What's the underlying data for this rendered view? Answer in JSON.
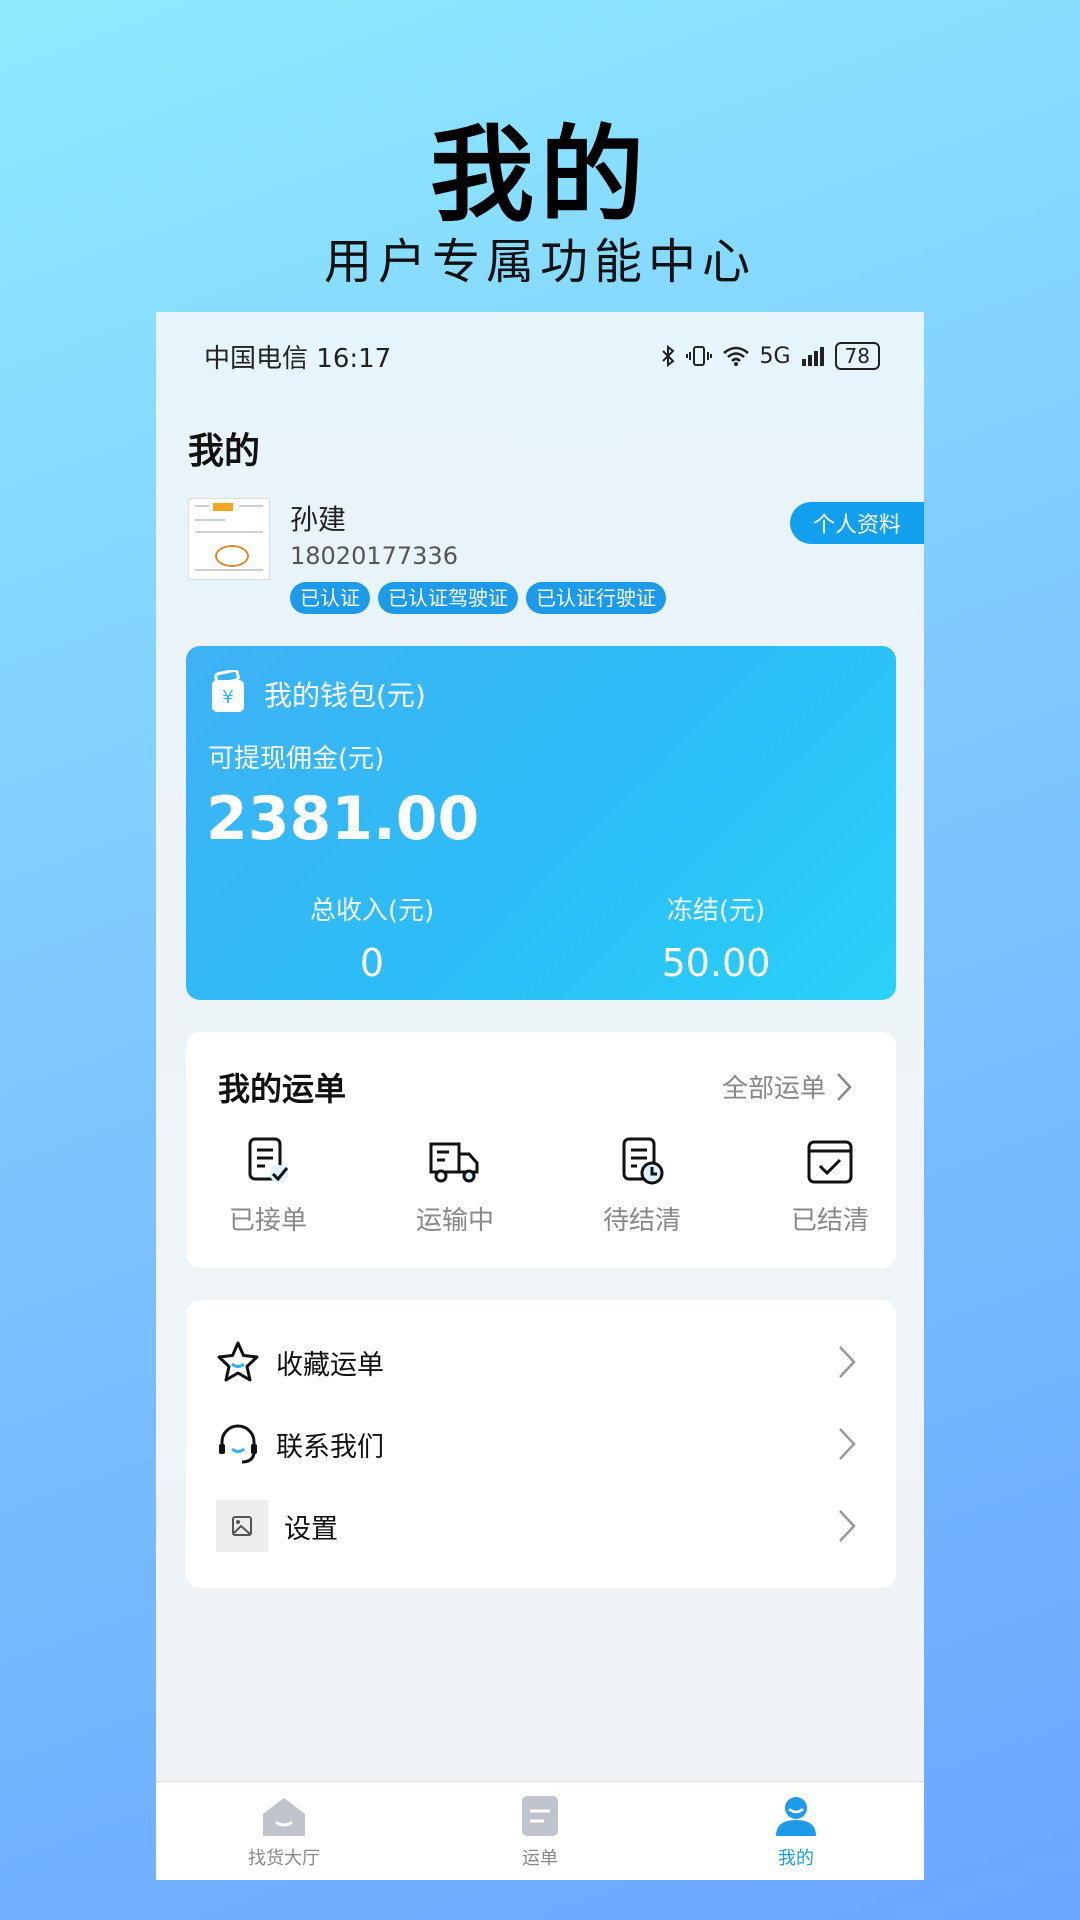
{
  "promo": {
    "title": "我的",
    "subtitle": "用户专属功能中心"
  },
  "status_bar": {
    "carrier": "中国电信",
    "time": "16:17",
    "network": "5G",
    "battery": "78"
  },
  "page": {
    "title": "我的"
  },
  "user": {
    "name": "孙建",
    "phone": "18020177336",
    "tags": [
      "已认证",
      "已认证驾驶证",
      "已认证行驶证"
    ],
    "profile_button": "个人资料"
  },
  "wallet": {
    "title": "我的钱包(元)",
    "withdrawable_label": "可提现佣金(元)",
    "withdrawable_amount": "2381.00",
    "income_label": "总收入(元)",
    "income_value": "0",
    "frozen_label": "冻结(元)",
    "frozen_value": "50.00"
  },
  "orders": {
    "title": "我的运单",
    "all_label": "全部运单",
    "items": [
      {
        "label": "已接单",
        "icon": "order-accepted-icon"
      },
      {
        "label": "运输中",
        "icon": "truck-icon"
      },
      {
        "label": "待结清",
        "icon": "pending-clock-icon"
      },
      {
        "label": "已结清",
        "icon": "settled-check-icon"
      }
    ]
  },
  "menu": {
    "items": [
      {
        "label": "收藏运单",
        "icon": "star-icon"
      },
      {
        "label": "联系我们",
        "icon": "headset-icon"
      },
      {
        "label": "设置",
        "icon": "image-placeholder-icon"
      }
    ]
  },
  "tabbar": {
    "items": [
      {
        "label": "找货大厅",
        "icon": "home-icon"
      },
      {
        "label": "运单",
        "icon": "waybill-icon"
      },
      {
        "label": "我的",
        "icon": "profile-icon"
      }
    ],
    "active_index": 2
  },
  "colors": {
    "accent": "#1E9BE8",
    "wallet_start": "#3FB2F5",
    "wallet_end": "#2AD2F8"
  }
}
